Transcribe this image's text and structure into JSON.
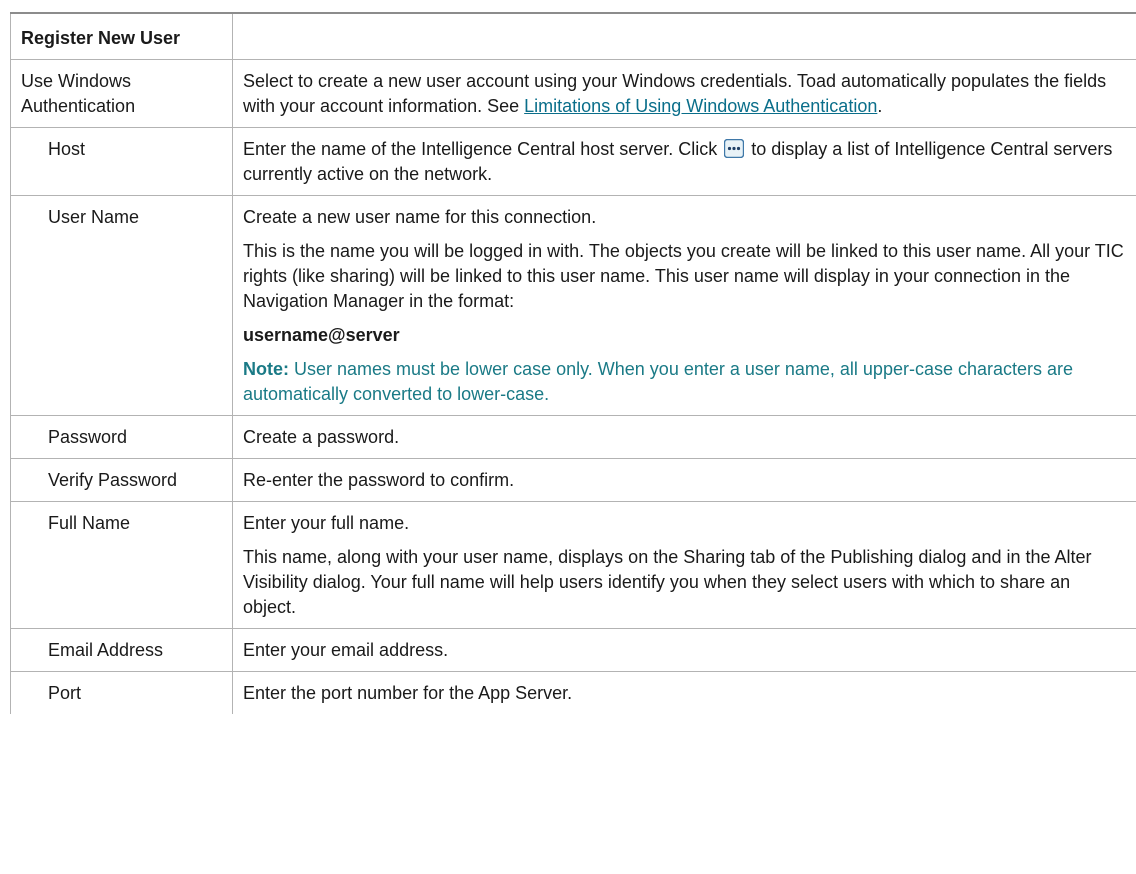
{
  "table": {
    "header": {
      "title": "Register New User"
    },
    "rows": [
      {
        "label": "Use Windows Authentication",
        "text_before": "Select to create a new user account using your Windows credentials. Toad automatically populates the fields with your account information. See ",
        "link": "Limitations of Using Windows Authentication",
        "text_after": "."
      },
      {
        "label": "Host",
        "text_before": "Enter the name of the Intelligence Central host server. Click ",
        "icon": "browse-ellipsis-icon",
        "text_after": " to display a list of Intelligence Central servers currently active on the network."
      },
      {
        "label": "User Name",
        "p1": "Create a new user name for this connection.",
        "p2": "This is the name you will be logged in with. The objects you create will be linked to this user name. All your TIC rights (like sharing) will be linked to this user name. This user name will display in your connection in the Navigation Manager in the format:",
        "p3": "username@server",
        "note_label": "Note:",
        "note_text": " User names must be lower case only. When you enter a user name, all upper-case characters are automatically converted to lower-case."
      },
      {
        "label": "Password",
        "p1": "Create a password."
      },
      {
        "label": "Verify Password",
        "p1": "Re-enter the password to confirm."
      },
      {
        "label": "Full Name",
        "p1": "Enter your full name.",
        "p2": "This name, along with your user name, displays on the Sharing tab of the Publishing dialog and in the Alter Visibility dialog. Your full name will help users identify you when they select users with which to share an object."
      },
      {
        "label": "Email Address",
        "p1": "Enter your email address."
      },
      {
        "label": "Port",
        "p1": "Enter the port number for the App Server."
      }
    ]
  },
  "colors": {
    "link": "#0a6e8a",
    "note": "#1a7a86",
    "border": "#b3b3b3"
  }
}
